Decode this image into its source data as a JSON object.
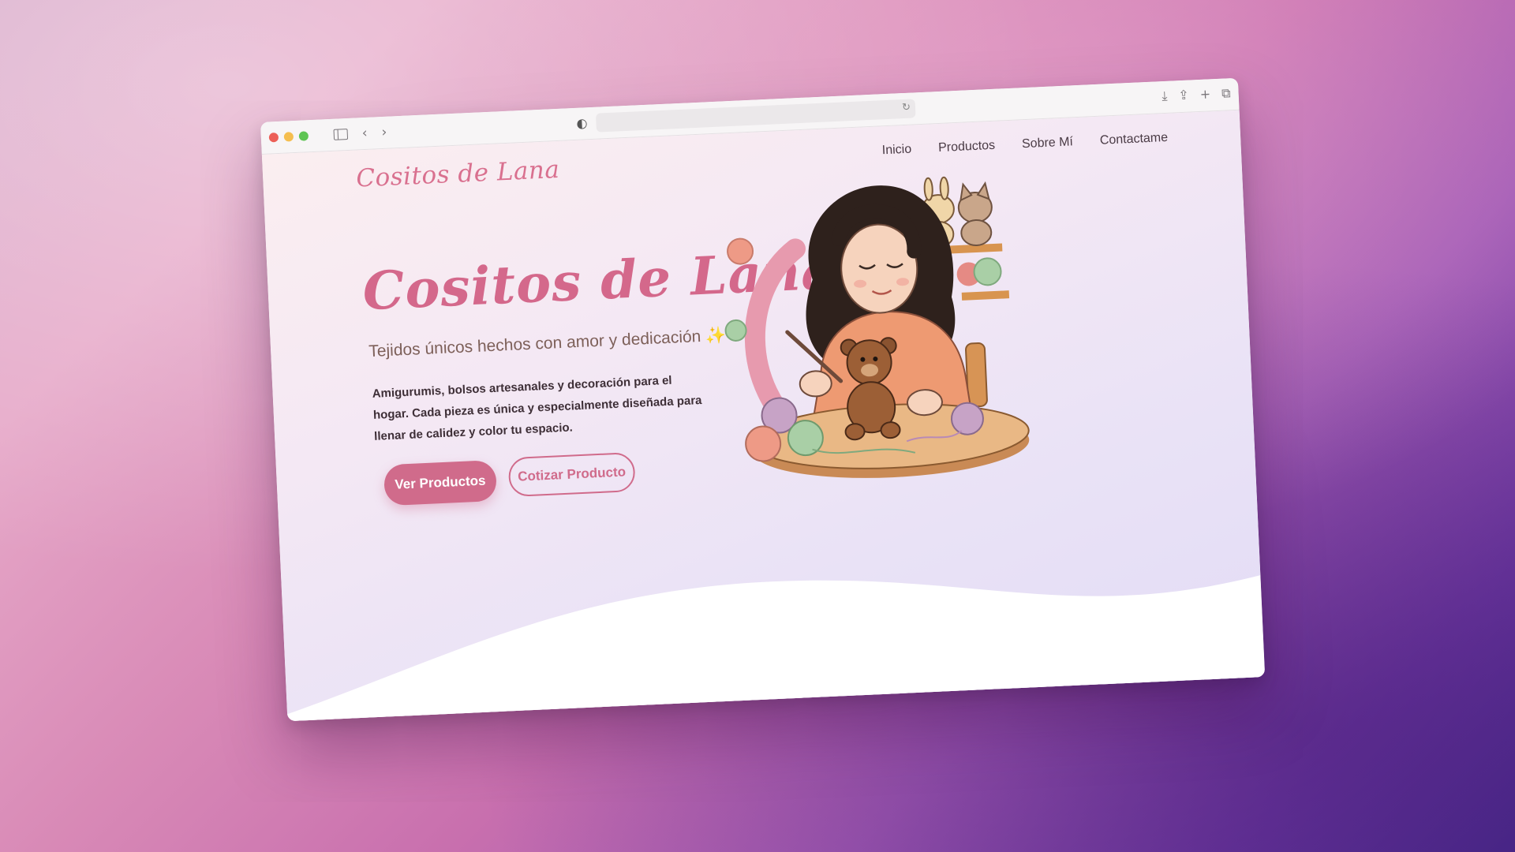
{
  "browser": {
    "url": "",
    "controls": {
      "back": "‹",
      "forward": "›",
      "reload": "↻",
      "shield": "◐",
      "download": "⤓",
      "share": "⇪",
      "new_tab": "+",
      "tabs": "⧉"
    }
  },
  "site": {
    "brand": "Cositos de Lana",
    "nav": [
      "Inicio",
      "Productos",
      "Sobre Mí",
      "Contactame"
    ]
  },
  "hero": {
    "title": "Cositos de Lana",
    "subtitle": "Tejidos únicos hechos con amor y dedicación",
    "subtitle_emoji": "✨",
    "description": "Amigurumis, bolsos artesanales y decoración para el hogar. Cada pieza es única y especialmente diseñada para llenar de calidez y color tu espacio.",
    "primary_button": "Ver Productos",
    "secondary_button": "Cotizar Producto"
  },
  "colors": {
    "accent": "#d06b8b",
    "text_dark": "#3e2f37",
    "subtitle": "#7d6059"
  },
  "illustration": {
    "icons": [
      "crochet-woman-illustration",
      "teddy-bear-icon",
      "bunny-amigurumi-icon",
      "cat-amigurumi-icon",
      "yarn-ball-icon"
    ]
  }
}
